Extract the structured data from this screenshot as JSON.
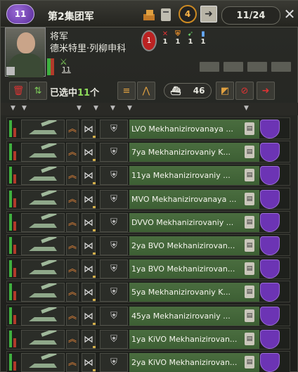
{
  "header": {
    "army_badge": "11",
    "army_name": "第2集团军",
    "planning_value": "4",
    "division_count": "11/24"
  },
  "commander": {
    "rank": "将军",
    "name": "德米特里·列柳申科",
    "skill_level": "1",
    "attack": "1",
    "defense": "1",
    "planning": "1",
    "logistics": "1",
    "experience": "11"
  },
  "toolbar": {
    "selected_prefix": "已选中",
    "selected_count": "11",
    "selected_suffix": "个",
    "naval_count": "46"
  },
  "divisions": [
    {
      "name": "LVO Mekhanizirovanaya ..."
    },
    {
      "name": "7ya Mekhanizirovaniy K..."
    },
    {
      "name": "11ya Mekhanizirovaniy ..."
    },
    {
      "name": "MVO Mekhanizirovanaya ..."
    },
    {
      "name": "DVVO Mekhanizirovaniy ..."
    },
    {
      "name": "2ya BVO Mekhanizirovan..."
    },
    {
      "name": "1ya BVO Mekhanizirovan..."
    },
    {
      "name": "5ya Mekhanizirovaniy K..."
    },
    {
      "name": "45ya Mekhanizirovaniy ..."
    },
    {
      "name": "1ya KiVO Mekhanizirovan..."
    },
    {
      "name": "2ya KiVO Mekhanizirovan..."
    }
  ],
  "colors": {
    "accent_purple": "#6c34b4",
    "name_green": "#4a6d3f",
    "strength_green": "#3fb03f"
  }
}
